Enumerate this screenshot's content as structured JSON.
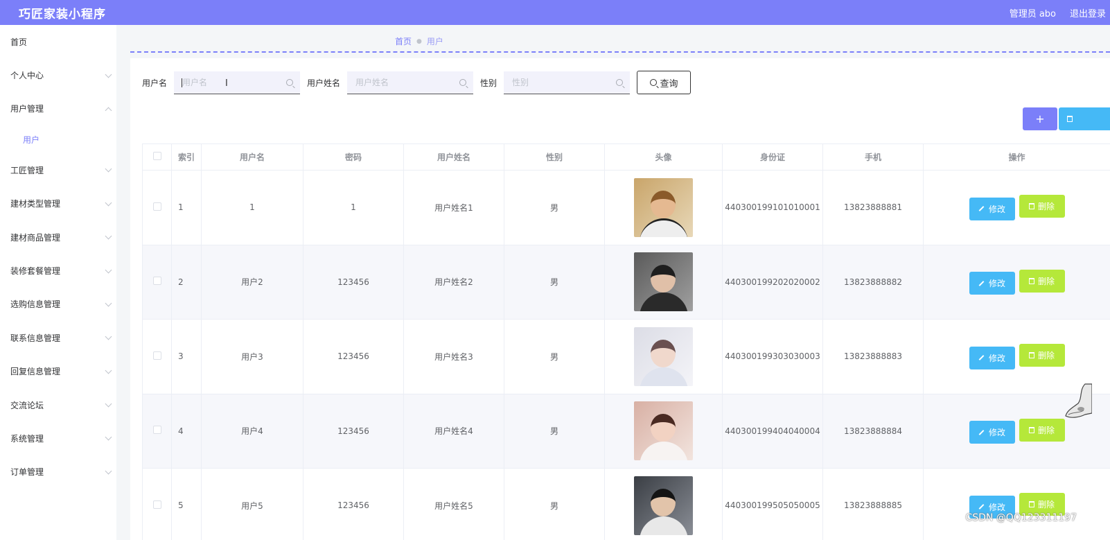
{
  "header": {
    "title": "巧匠家装小程序",
    "admin": "管理员 abo",
    "logout": "退出登录"
  },
  "sidebar": {
    "items": [
      {
        "label": "首页",
        "chevron": "none"
      },
      {
        "label": "个人中心",
        "chevron": "down"
      },
      {
        "label": "用户管理",
        "chevron": "up"
      },
      {
        "label": "工匠管理",
        "chevron": "down"
      },
      {
        "label": "建材类型管理",
        "chevron": "down"
      },
      {
        "label": "建材商品管理",
        "chevron": "down"
      },
      {
        "label": "装修套餐管理",
        "chevron": "down"
      },
      {
        "label": "选购信息管理",
        "chevron": "down"
      },
      {
        "label": "联系信息管理",
        "chevron": "down"
      },
      {
        "label": "回复信息管理",
        "chevron": "down"
      },
      {
        "label": "交流论坛",
        "chevron": "down"
      },
      {
        "label": "系统管理",
        "chevron": "down"
      },
      {
        "label": "订单管理",
        "chevron": "down"
      }
    ],
    "sub_item": "用户"
  },
  "breadcrumb": {
    "home": "首页",
    "current": "用户"
  },
  "search": {
    "username_label": "用户名",
    "username_placeholder": "用户名",
    "realname_label": "用户姓名",
    "realname_placeholder": "用户姓名",
    "gender_label": "性别",
    "gender_placeholder": "性别",
    "query_button": "查询"
  },
  "toolbar": {
    "add_label": "+"
  },
  "table": {
    "headers": [
      "索引",
      "用户名",
      "密码",
      "用户姓名",
      "性别",
      "头像",
      "身份证",
      "手机",
      "操作"
    ],
    "edit_label": "修改",
    "delete_label": "删除",
    "rows": [
      {
        "index": "1",
        "username": "1",
        "password": "1",
        "realname": "用户姓名1",
        "gender": "男",
        "idcard": "440300199101010001",
        "phone": "13823888881"
      },
      {
        "index": "2",
        "username": "用户2",
        "password": "123456",
        "realname": "用户姓名2",
        "gender": "男",
        "idcard": "440300199202020002",
        "phone": "13823888882"
      },
      {
        "index": "3",
        "username": "用户3",
        "password": "123456",
        "realname": "用户姓名3",
        "gender": "男",
        "idcard": "440300199303030003",
        "phone": "13823888883"
      },
      {
        "index": "4",
        "username": "用户4",
        "password": "123456",
        "realname": "用户姓名4",
        "gender": "男",
        "idcard": "440300199404040004",
        "phone": "13823888884"
      },
      {
        "index": "5",
        "username": "用户5",
        "password": "123456",
        "realname": "用户姓名5",
        "gender": "男",
        "idcard": "440300199505050005",
        "phone": "13823888885"
      }
    ]
  },
  "watermark": "CSDN @QQ123311197",
  "colors": {
    "accent": "#7b7ff9",
    "edit": "#45b9f6",
    "delete": "#b5e83a"
  }
}
